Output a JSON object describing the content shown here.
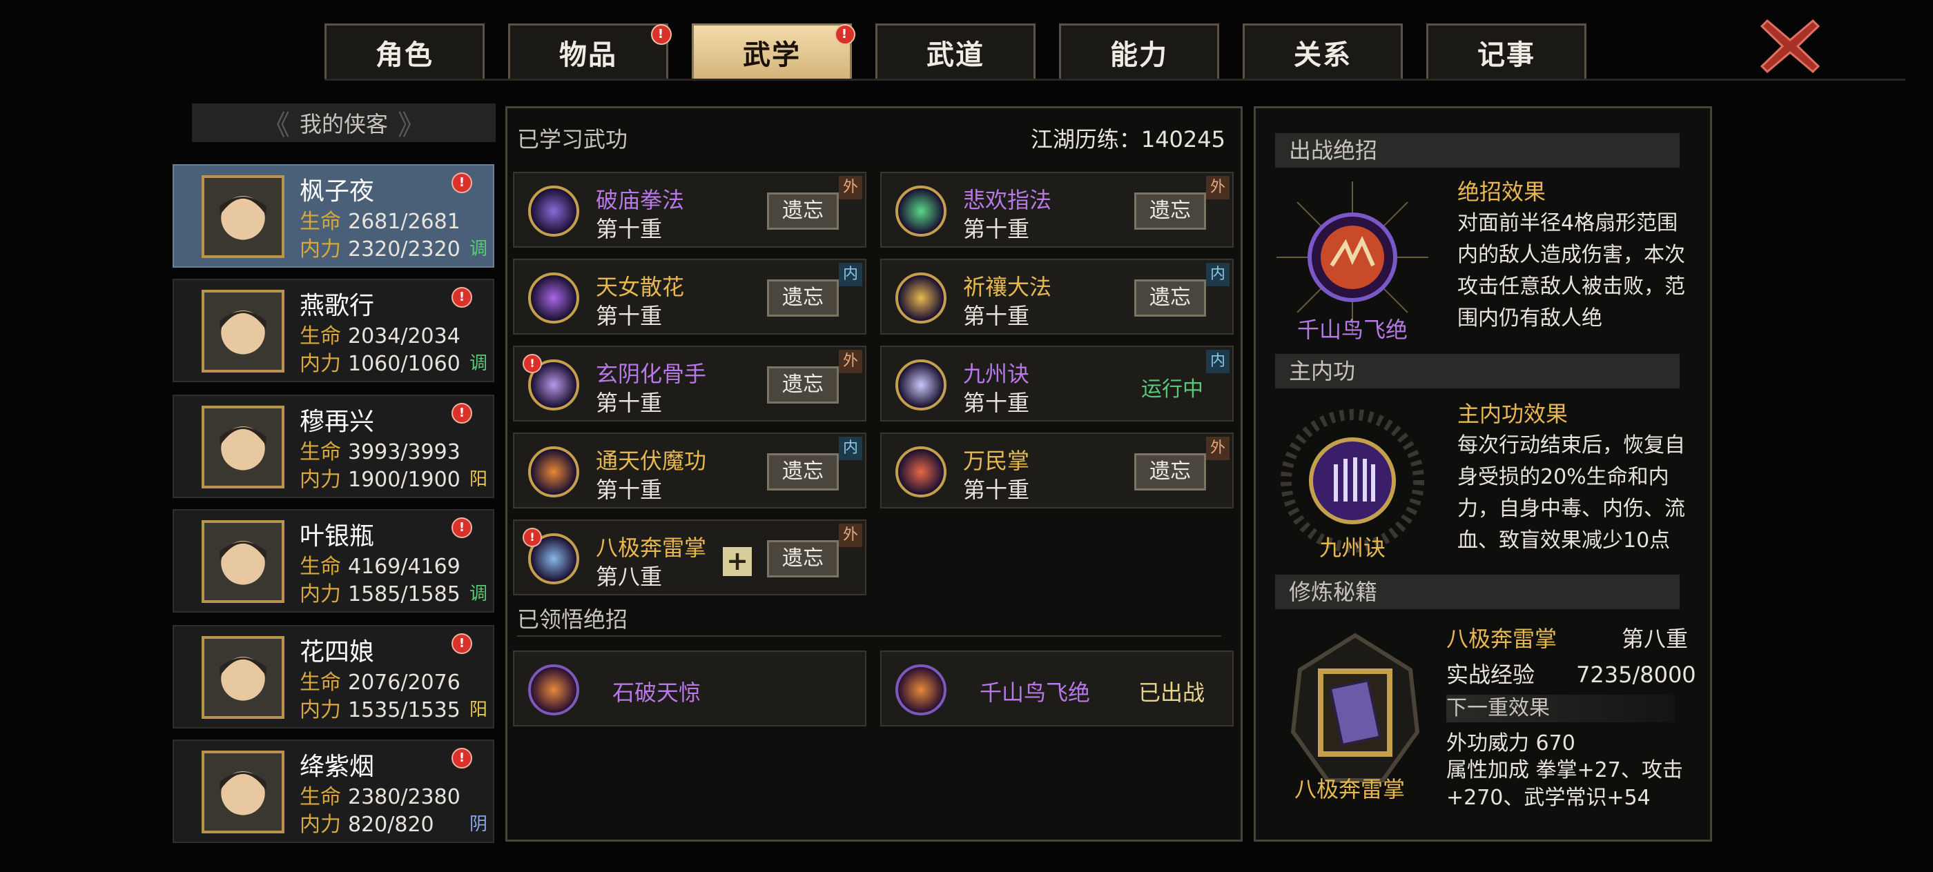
{
  "tabs": [
    {
      "label": "角色",
      "alert": false,
      "active": false
    },
    {
      "label": "物品",
      "alert": true,
      "active": false
    },
    {
      "label": "武学",
      "alert": true,
      "active": true
    },
    {
      "label": "武道",
      "alert": false,
      "active": false
    },
    {
      "label": "能力",
      "alert": false,
      "active": false
    },
    {
      "label": "关系",
      "alert": false,
      "active": false
    },
    {
      "label": "记事",
      "alert": false,
      "active": false
    }
  ],
  "alert_glyph": "!",
  "list_title": "我的侠客",
  "heroes": [
    {
      "name": "枫子夜",
      "hp_label": "生命",
      "hp": "2681/2681",
      "mp_label": "内力",
      "mp": "2320/2320",
      "tag": "调",
      "tag_color": "#58c878"
    },
    {
      "name": "燕歌行",
      "hp_label": "生命",
      "hp": "2034/2034",
      "mp_label": "内力",
      "mp": "1060/1060",
      "tag": "调",
      "tag_color": "#58c878"
    },
    {
      "name": "穆再兴",
      "hp_label": "生命",
      "hp": "3993/3993",
      "mp_label": "内力",
      "mp": "1900/1900",
      "tag": "阳",
      "tag_color": "#e8c850"
    },
    {
      "name": "叶银瓶",
      "hp_label": "生命",
      "hp": "4169/4169",
      "mp_label": "内力",
      "mp": "1585/1585",
      "tag": "调",
      "tag_color": "#58c878"
    },
    {
      "name": "花四娘",
      "hp_label": "生命",
      "hp": "2076/2076",
      "mp_label": "内力",
      "mp": "1535/1535",
      "tag": "阳",
      "tag_color": "#e8c850"
    },
    {
      "name": "绛紫烟",
      "hp_label": "生命",
      "hp": "2380/2380",
      "mp_label": "内力",
      "mp": "820/820",
      "tag": "阴",
      "tag_color": "#88a8e8"
    }
  ],
  "center": {
    "learned_title": "已学习武功",
    "xp": "江湖历练：140245",
    "forget_label": "遗忘",
    "skills": [
      {
        "name": "破庙拳法",
        "level": "第十重",
        "type": "外",
        "name_color": "#b878e8",
        "status": "",
        "alert": false,
        "plus": false,
        "icon_color": "#8a6ad8"
      },
      {
        "name": "悲欢指法",
        "level": "第十重",
        "type": "外",
        "name_color": "#b878e8",
        "status": "",
        "alert": false,
        "plus": false,
        "icon_color": "#58d888"
      },
      {
        "name": "天女散花",
        "level": "第十重",
        "type": "内",
        "name_color": "#e8b850",
        "status": "",
        "alert": false,
        "plus": false,
        "icon_color": "#a868e8"
      },
      {
        "name": "祈禳大法",
        "level": "第十重",
        "type": "内",
        "name_color": "#e8b850",
        "status": "",
        "alert": false,
        "plus": false,
        "icon_color": "#e8b850"
      },
      {
        "name": "玄阴化骨手",
        "level": "第十重",
        "type": "外",
        "name_color": "#b878e8",
        "status": "",
        "alert": true,
        "plus": false,
        "icon_color": "#b898e8"
      },
      {
        "name": "九州诀",
        "level": "第十重",
        "type": "内",
        "name_color": "#b878e8",
        "status": "运行中",
        "alert": false,
        "plus": false,
        "icon_color": "#c8c8f8"
      },
      {
        "name": "通天伏魔功",
        "level": "第十重",
        "type": "内",
        "name_color": "#e8b850",
        "status": "",
        "alert": false,
        "plus": false,
        "icon_color": "#e88838"
      },
      {
        "name": "万民掌",
        "level": "第十重",
        "type": "外",
        "name_color": "#e8b850",
        "status": "",
        "alert": false,
        "plus": false,
        "icon_color": "#e86848"
      },
      {
        "name": "八极奔雷掌",
        "level": "第八重",
        "type": "外",
        "name_color": "#e8b850",
        "status": "",
        "alert": true,
        "plus": true,
        "icon_color": "#88b8e8"
      }
    ],
    "ult_title": "已领悟绝招",
    "ults": [
      {
        "name": "石破天惊",
        "status": ""
      },
      {
        "name": "千山鸟飞绝",
        "status": "已出战"
      }
    ]
  },
  "right": {
    "battle_title": "出战绝招",
    "battle_name": "千山鸟飞绝",
    "battle_effect_title": "绝招效果",
    "battle_effect": "对面前半径4格扇形范围内的敌人造成伤害，本次攻击任意敌人被击败，范围内仍有敌人绝",
    "inner_title": "主内功",
    "inner_name": "九州诀",
    "inner_effect_title": "主内功效果",
    "inner_effect": "每次行动结束后，恢复自身受损的20%生命和内力，自身中毒、内伤、流血、致盲效果减少10点",
    "book_title": "修炼秘籍",
    "book_name": "八极奔雷掌",
    "book_skill": "八极奔雷掌",
    "book_level": "第八重",
    "exp_label": "实战经验",
    "exp_value": "7235/8000",
    "next_label": "下一重效果",
    "power_label": "外功威力",
    "power_value": "670",
    "attr_label": "属性加成",
    "attr_value": "拳掌+27、攻击+270、武学常识+54"
  }
}
